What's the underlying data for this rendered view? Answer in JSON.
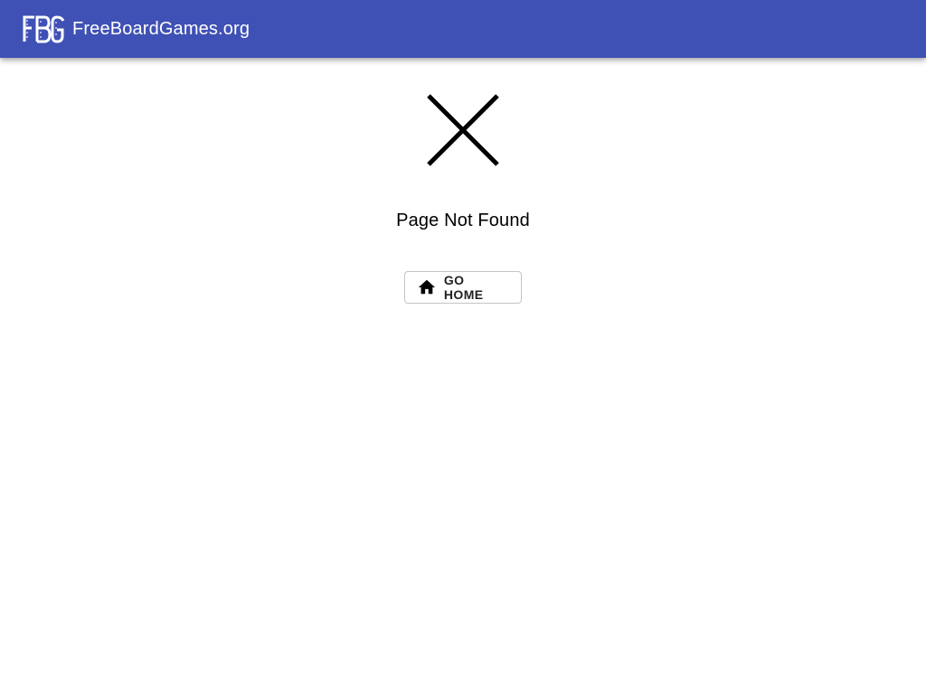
{
  "header": {
    "logo_text": "FBG",
    "brand_name": "FreeBoardGames.org",
    "background_color": "#3f51b5",
    "logo_icon": "fbg-logo-icon"
  },
  "main": {
    "error_icon": "close-icon",
    "message": "Page Not Found",
    "home_button": {
      "label": "GO HOME",
      "icon": "home-icon"
    }
  }
}
